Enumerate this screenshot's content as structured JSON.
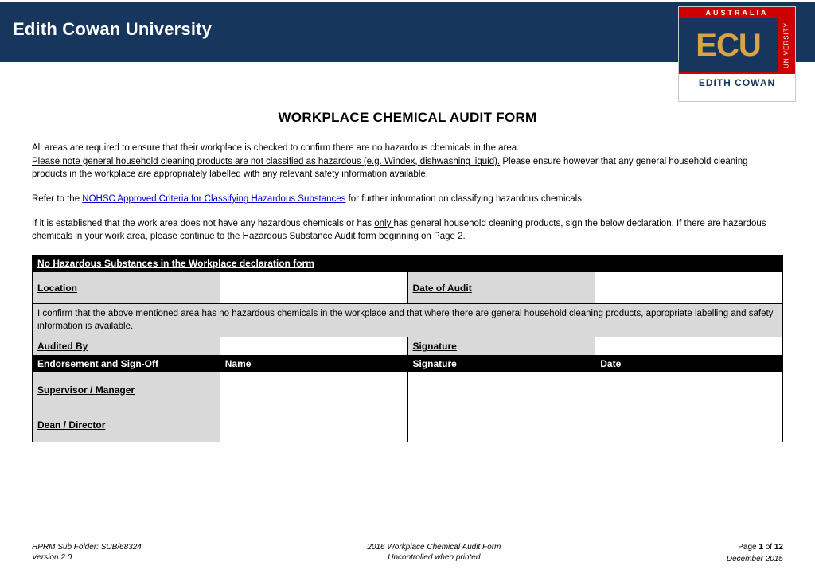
{
  "header": {
    "university": "Edith Cowan University",
    "logo": {
      "top": "AUSTRALIA",
      "main": "ECU",
      "side": "UNIVERSITY",
      "bottom": "EDITH COWAN"
    }
  },
  "title": "WORKPLACE CHEMICAL AUDIT FORM",
  "intro": {
    "line1": "All areas are required to ensure that their workplace is checked to confirm there are no hazardous chemicals in the area.",
    "line2_u": "Please note general household cleaning products are not classified as hazardous (e.g. Windex, dishwashing liquid).",
    "line2_rest": " Please ensure however that any general household cleaning products in the workplace are appropriately labelled with any relevant safety information available.",
    "refer_pre": "Refer to the ",
    "refer_link": "NOHSC Approved Criteria for Classifying Hazardous Substances",
    "refer_post": " for further information on classifying hazardous chemicals.",
    "decl1": "If it is established that the work area does not have any hazardous chemicals or has ",
    "decl_only": "only ",
    "decl2": "has general household cleaning products, sign the below declaration. If there are hazardous chemicals in your work area, please continue to the Hazardous Substance Audit form beginning on Page 2."
  },
  "table": {
    "header_row": "No Hazardous Substances in the Workplace declaration form",
    "location": "Location",
    "date_of_audit": "Date of Audit",
    "confirm": "I confirm that the above mentioned area has no hazardous chemicals in the workplace and that where there are general household cleaning products, appropriate labelling and safety information is available.",
    "audited_by": "Audited By",
    "signature": "Signature",
    "endorsement": "Endorsement and Sign-Off",
    "name": "Name",
    "signature2": "Signature",
    "date": "Date",
    "supervisor": "Supervisor / Manager",
    "dean": "Dean / Director"
  },
  "footer": {
    "left1": "HPRM Sub Folder: SUB/68324",
    "left2": "Version 2.0",
    "center1": "2016 Workplace Chemical Audit Form",
    "center2": "Uncontrolled when printed",
    "page_pre": "Page ",
    "page_num": "1",
    "page_of": " of ",
    "page_total": "12",
    "right2": "December 2015"
  }
}
